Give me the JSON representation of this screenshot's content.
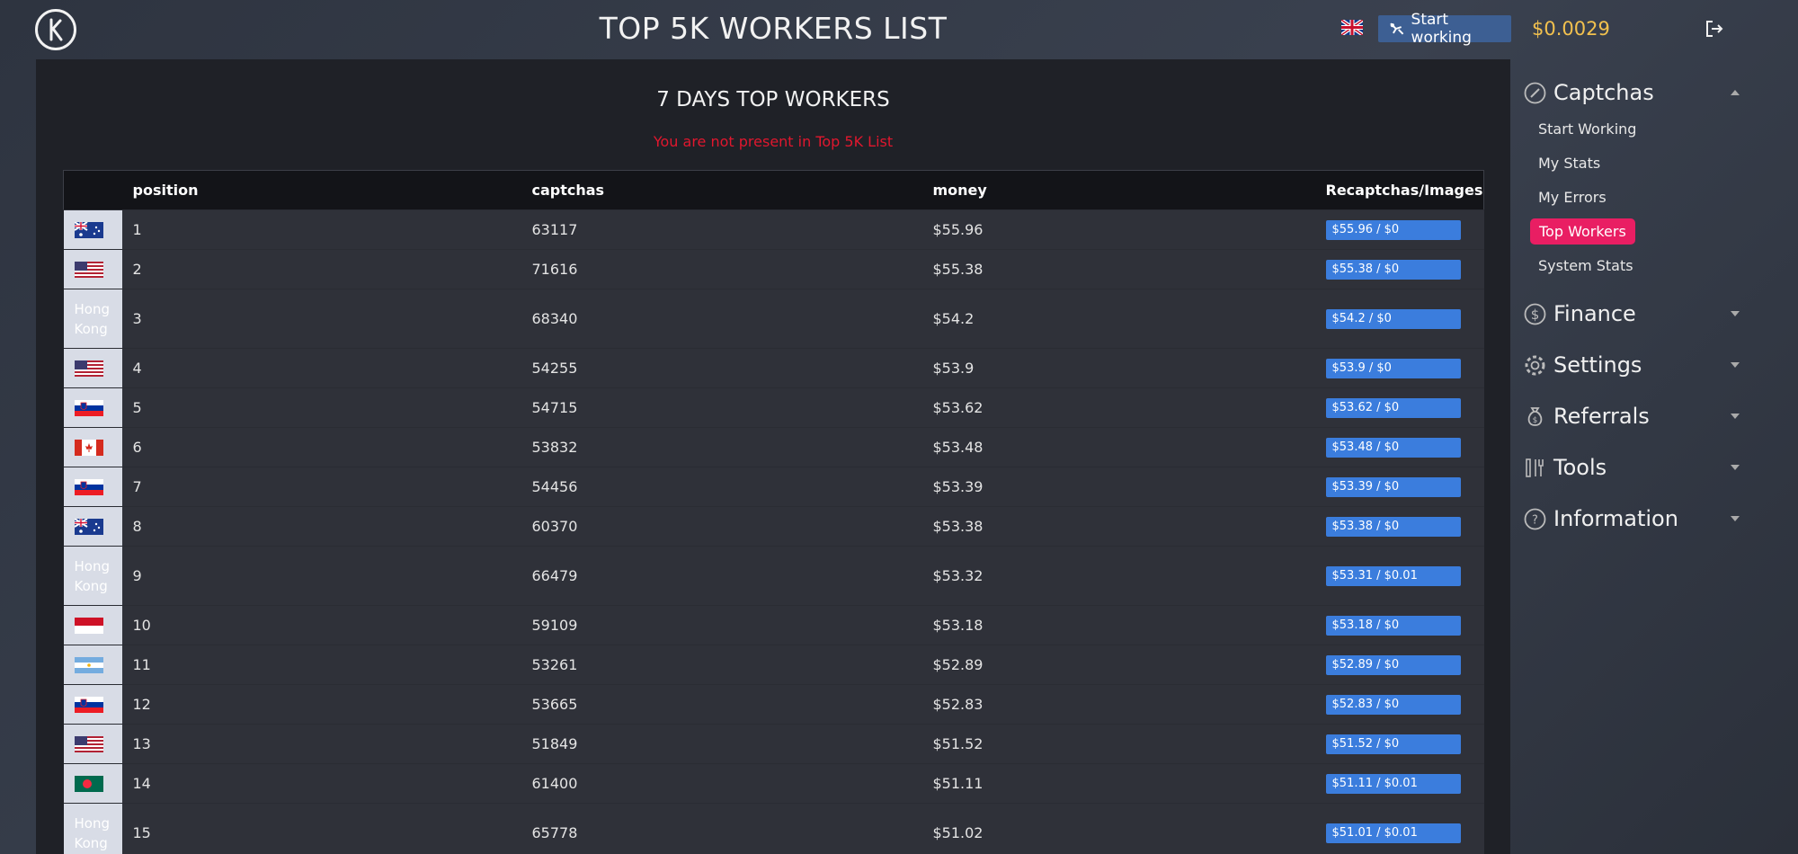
{
  "header": {
    "title": "TOP 5K WORKERS LIST",
    "start_button_label": "Start working",
    "balance": "$0.0029"
  },
  "main": {
    "section_title": "7 DAYS TOP WORKERS",
    "warning": "You are not present in Top 5K List",
    "columns": [
      "position",
      "captchas",
      "money",
      "Recaptchas/Images"
    ],
    "rows": [
      {
        "flag": "au",
        "position": "1",
        "captchas": "63117",
        "money": "$55.96",
        "split": "$55.96 / $0"
      },
      {
        "flag": "us",
        "position": "2",
        "captchas": "71616",
        "money": "$55.38",
        "split": "$55.38 / $0"
      },
      {
        "flag": "hk",
        "country_text": "Hong Kong",
        "position": "3",
        "captchas": "68340",
        "money": "$54.2",
        "split": "$54.2 / $0"
      },
      {
        "flag": "us",
        "position": "4",
        "captchas": "54255",
        "money": "$53.9",
        "split": "$53.9 / $0"
      },
      {
        "flag": "si",
        "position": "5",
        "captchas": "54715",
        "money": "$53.62",
        "split": "$53.62 / $0"
      },
      {
        "flag": "ca",
        "position": "6",
        "captchas": "53832",
        "money": "$53.48",
        "split": "$53.48 / $0"
      },
      {
        "flag": "si",
        "position": "7",
        "captchas": "54456",
        "money": "$53.39",
        "split": "$53.39 / $0"
      },
      {
        "flag": "au",
        "position": "8",
        "captchas": "60370",
        "money": "$53.38",
        "split": "$53.38 / $0"
      },
      {
        "flag": "hk",
        "country_text": "Hong Kong",
        "position": "9",
        "captchas": "66479",
        "money": "$53.32",
        "split": "$53.31 / $0.01"
      },
      {
        "flag": "id",
        "position": "10",
        "captchas": "59109",
        "money": "$53.18",
        "split": "$53.18 / $0"
      },
      {
        "flag": "ar",
        "position": "11",
        "captchas": "53261",
        "money": "$52.89",
        "split": "$52.89 / $0"
      },
      {
        "flag": "si",
        "position": "12",
        "captchas": "53665",
        "money": "$52.83",
        "split": "$52.83 / $0"
      },
      {
        "flag": "us",
        "position": "13",
        "captchas": "51849",
        "money": "$51.52",
        "split": "$51.52 / $0"
      },
      {
        "flag": "bd",
        "position": "14",
        "captchas": "61400",
        "money": "$51.11",
        "split": "$51.11 / $0.01"
      },
      {
        "flag": "hk",
        "country_text": "Hong Kong",
        "position": "15",
        "captchas": "65778",
        "money": "$51.02",
        "split": "$51.01 / $0.01"
      }
    ]
  },
  "sidebar": {
    "groups": [
      {
        "title": "Captchas",
        "icon": "compass-icon",
        "expanded": true,
        "items": [
          "Start Working",
          "My Stats",
          "My Errors",
          "Top Workers",
          "System Stats"
        ],
        "active_item": "Top Workers"
      },
      {
        "title": "Finance",
        "icon": "dollar-icon",
        "expanded": false
      },
      {
        "title": "Settings",
        "icon": "gear-icon",
        "expanded": false
      },
      {
        "title": "Referrals",
        "icon": "money-bag-icon",
        "expanded": false
      },
      {
        "title": "Tools",
        "icon": "tools-icon",
        "expanded": false
      },
      {
        "title": "Information",
        "icon": "help-icon",
        "expanded": false
      }
    ]
  },
  "colors": {
    "accent_blue": "#3b7ddd",
    "active_pink": "#e91e63",
    "balance_gold": "#f2c14e",
    "warning_red": "#e0172e"
  }
}
